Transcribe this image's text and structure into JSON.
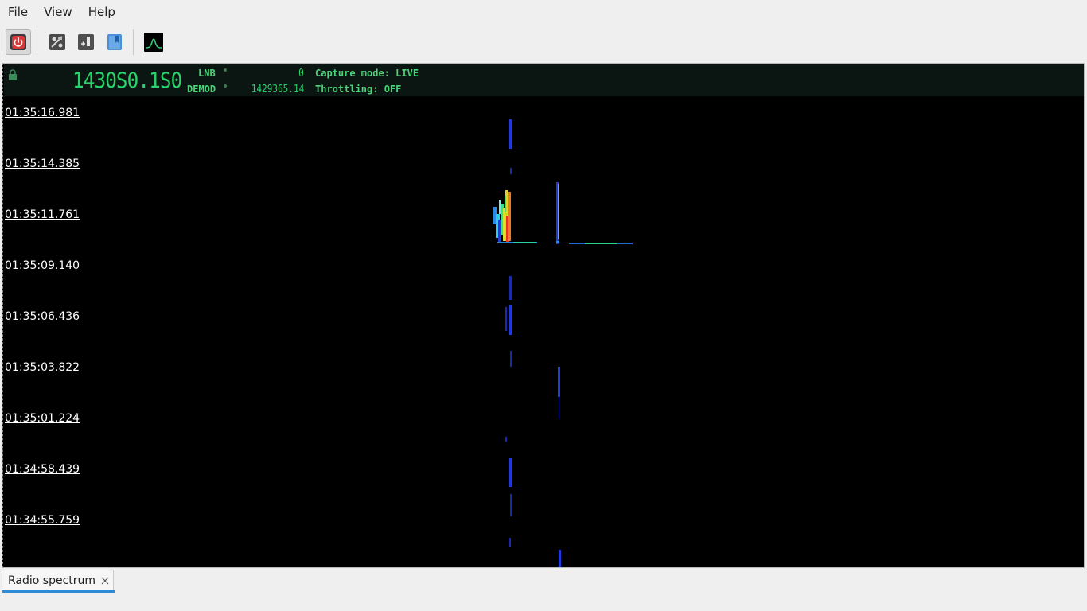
{
  "menu": {
    "items": [
      {
        "label": "File"
      },
      {
        "label": "View"
      },
      {
        "label": "Help"
      }
    ]
  },
  "toolbar": {
    "icons": [
      "power-icon",
      "settings-icon",
      "add-bookmark-icon",
      "bookmarks-icon",
      "spectrum-icon"
    ]
  },
  "info": {
    "frequency": "1430S0.1S0",
    "lnb_label": "LNB",
    "lnb_value": "0",
    "demod_label": "DEMOD",
    "demod_value": "1429365.14",
    "capture_mode": "Capture mode: LIVE",
    "throttling": "Throttling: OFF"
  },
  "waterfall": {
    "timestamps": [
      "01:35:16.981",
      "01:35:14.385",
      "01:35:11.761",
      "01:35:09.140",
      "01:35:06.436",
      "01:35:03.822",
      "01:35:01.224",
      "01:34:58.439",
      "01:34:55.759"
    ]
  },
  "tabs": [
    {
      "label": "Radio spectrum"
    }
  ],
  "colors": {
    "lcd_green": "#27d36a",
    "info_bg": "#0b1612",
    "tab_accent": "#2f8bd8"
  }
}
